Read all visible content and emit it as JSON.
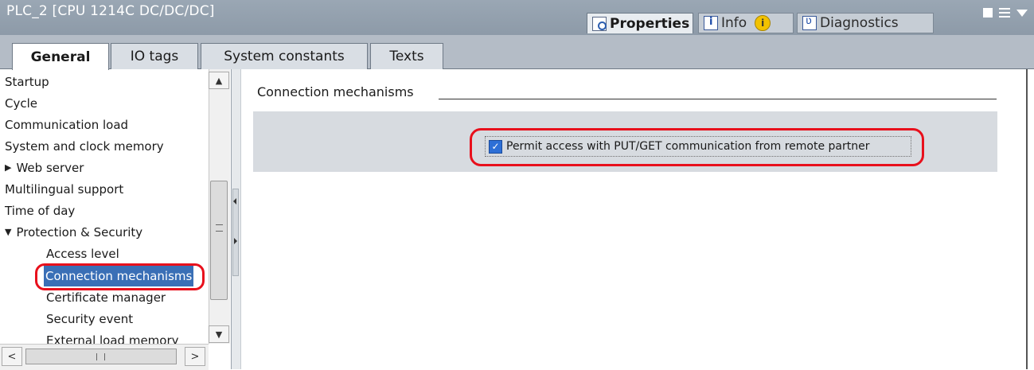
{
  "window": {
    "title": "PLC_2 [CPU 1214C DC/DC/DC]",
    "inspector_tabs": [
      {
        "label": "Properties",
        "icon": "properties-icon",
        "active": true
      },
      {
        "label": "Info",
        "icon": "info-icon",
        "badge_icon": "info-warning-icon",
        "badge_text": "i"
      },
      {
        "label": "Diagnostics",
        "icon": "diagnostics-icon"
      }
    ]
  },
  "tabs": [
    {
      "label": "General",
      "active": true
    },
    {
      "label": "IO tags"
    },
    {
      "label": "System constants"
    },
    {
      "label": "Texts"
    }
  ],
  "nav": {
    "items": [
      {
        "label": "Startup",
        "level": 0
      },
      {
        "label": "Cycle",
        "level": 0
      },
      {
        "label": "Communication load",
        "level": 0
      },
      {
        "label": "System and clock memory",
        "level": 0
      },
      {
        "label": "Web server",
        "level": 0,
        "expander": "collapsed"
      },
      {
        "label": "Multilingual support",
        "level": 0
      },
      {
        "label": "Time of day",
        "level": 0
      },
      {
        "label": "Protection & Security",
        "level": 0,
        "expander": "expanded"
      },
      {
        "label": "Access level",
        "level": 1
      },
      {
        "label": "Connection mechanisms",
        "level": 1,
        "selected": true
      },
      {
        "label": "Certificate manager",
        "level": 1
      },
      {
        "label": "Security event",
        "level": 1
      },
      {
        "label": "External load memory",
        "level": 1
      }
    ]
  },
  "main": {
    "section_title": "Connection mechanisms",
    "permit_checkbox": {
      "label": "Permit access with PUT/GET communication from remote partner",
      "checked": true
    }
  },
  "colors": {
    "highlight": "#e8101c",
    "selection": "#3a6fb6",
    "titlebar": "#9aa7b4"
  }
}
